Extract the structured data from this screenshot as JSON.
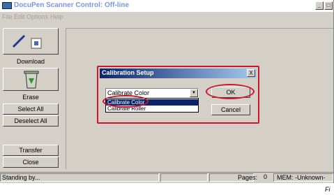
{
  "window": {
    "title": "DocuPen Scanner Control: Off-line"
  },
  "menu": [
    "File",
    "Edit",
    "Options",
    "Help"
  ],
  "sidebar": {
    "download_label": "Download",
    "erase_label": "Erase",
    "select_all": "Select All",
    "deselect_all": "Deselect All",
    "transfer": "Transfer",
    "close": "Close"
  },
  "status": {
    "text": "Standing by...",
    "pages_label": "Pages:",
    "pages_value": "0",
    "mem": "MEM: -Unknown-"
  },
  "dialog": {
    "title": "Calibration Setup",
    "close_glyph": "X",
    "combo_value": "Calibrate Color",
    "options": [
      "Calibrate Color",
      "Calibrate Roller"
    ],
    "ok": "OK",
    "cancel": "Cancel"
  },
  "caption": "Fi",
  "colors": {
    "highlight": "#d0142c",
    "face": "#d4d0c8",
    "title_blue": "#0a246a"
  }
}
